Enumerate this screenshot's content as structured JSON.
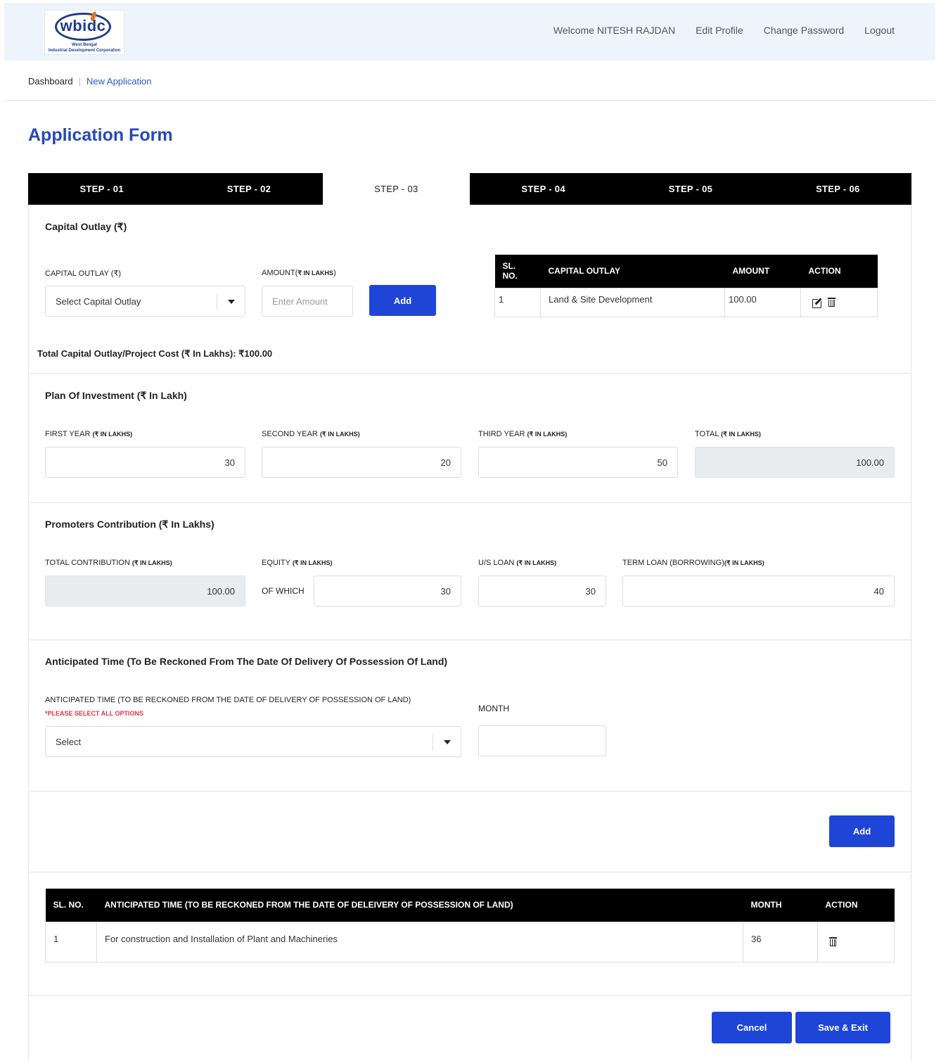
{
  "header": {
    "logo_text": "wbidc",
    "logo_sub1": "West Bengal",
    "logo_sub2": "Industrial Development Corporation",
    "nav": [
      "Welcome NITESH RAJDAN",
      "Edit Profile",
      "Change Password",
      "Logout"
    ]
  },
  "breadcrumb": {
    "home": "Dashboard",
    "sep": "|",
    "current": "New Application"
  },
  "page_title": "Application Form",
  "steps": [
    "STEP - 01",
    "STEP - 02",
    "STEP - 03",
    "STEP - 04",
    "STEP - 05",
    "STEP - 06"
  ],
  "active_step": "STEP - 03",
  "capital": {
    "title": "Capital Outlay (₹)",
    "outlay_label": "CAPITAL OUTLAY (₹)",
    "outlay_placeholder": "Select Capital Outlay",
    "amount_label": "AMOUNT(",
    "amount_label_unit": "₹ IN LAKHS",
    "amount_label_end": ")",
    "amount_placeholder": "Enter Amount",
    "add_label": "Add",
    "table_headers": [
      "SL. NO.",
      "CAPITAL OUTLAY",
      "AMOUNT",
      "ACTION"
    ],
    "rows": [
      {
        "sl": "1",
        "outlay": "Land & Site Development",
        "amount": "100.00"
      }
    ],
    "total_text": "Total Capital Outlay/Project Cost (₹ In Lakhs): ₹100.00"
  },
  "plan": {
    "title": "Plan Of Investment (₹ In Lakh)",
    "fields": [
      {
        "label": "FIRST YEAR ",
        "unit": "(₹ IN LAKHS)",
        "value": "30"
      },
      {
        "label": "SECOND YEAR ",
        "unit": "(₹ IN LAKHS)",
        "value": "20"
      },
      {
        "label": "THIRD YEAR ",
        "unit": "(₹ IN LAKHS)",
        "value": "50"
      },
      {
        "label": "TOTAL ",
        "unit": "(₹ IN LAKHS)",
        "value": "100.00"
      }
    ]
  },
  "promoters": {
    "title": "Promoters Contribution (₹ In Lakhs)",
    "total_label": "TOTAL CONTRIBUTION ",
    "total_unit": "(₹ IN LAKHS)",
    "total_value": "100.00",
    "equity_label": "EQUITY ",
    "equity_unit": "(₹ IN LAKHS)",
    "of_which": "OF WHICH",
    "equity_value": "30",
    "us_loan_label": "U/S LOAN ",
    "us_loan_unit": "(₹ IN LAKHS)",
    "us_loan_value": "30",
    "term_loan_label": "TERM LOAN (BORROWING)",
    "term_loan_unit": "(₹ IN LAKHS)",
    "term_loan_value": "40"
  },
  "anticipated": {
    "title": "Anticipated Time (To Be Reckoned From The Date Of Delivery Of Possession Of Land)",
    "select_label": "ANTICIPATED TIME (TO BE RECKONED FROM THE DATE OF DELIVERY OF POSSESSION OF LAND)",
    "required_note": "*PLEASE SELECT ALL OPTIONS",
    "select_value": "Select",
    "month_label": "MONTH",
    "add_label": "Add",
    "table_headers": [
      "SL. NO.",
      "ANTICIPATED TIME (TO BE RECKONED FROM THE DATE OF DELEIVERY OF POSSESSION OF LAND)",
      "MONTH",
      "ACTION"
    ],
    "rows": [
      {
        "sl": "1",
        "time": "For construction and Installation of Plant and Machineries",
        "month": "36"
      }
    ]
  },
  "footer": {
    "cancel_label": "Cancel",
    "save_label": "Save & Exit"
  },
  "colors": {
    "primary": "#1e45d6",
    "title": "#2748b8",
    "header_bg": "#eef4fb",
    "required": "#e0334c"
  }
}
